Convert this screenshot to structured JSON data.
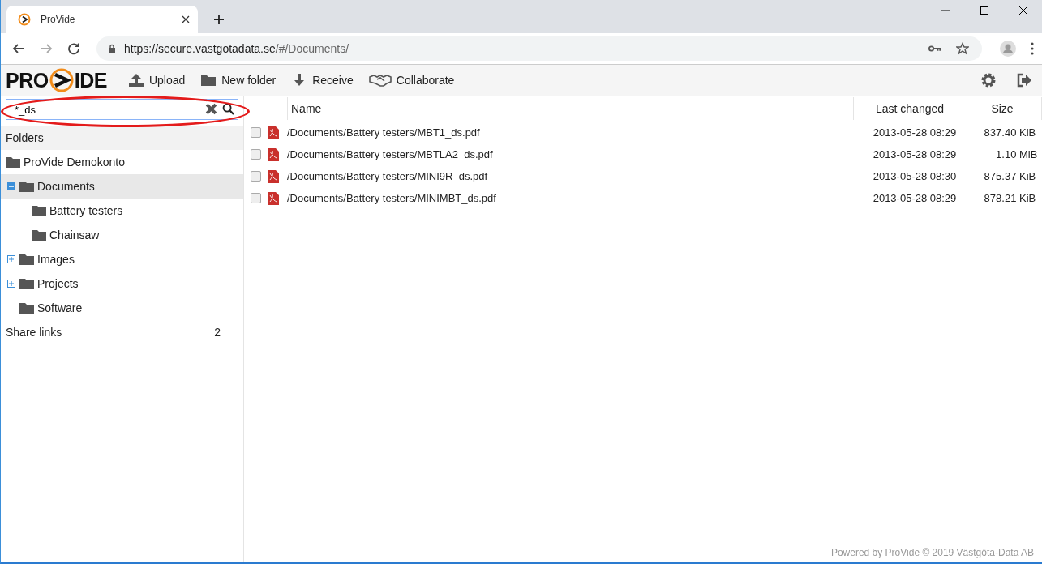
{
  "browser": {
    "tab_title": "ProVide",
    "url_host": "https://secure.vastgotadata.se",
    "url_path": "/#/Documents/"
  },
  "logo": {
    "left": "PRO",
    "right": "IDE"
  },
  "toolbar": [
    {
      "label": "Upload",
      "kind": "upload"
    },
    {
      "label": "New folder",
      "kind": "folder"
    },
    {
      "label": "Receive",
      "kind": "receive"
    },
    {
      "label": "Collaborate",
      "kind": "handshake"
    }
  ],
  "search": {
    "value": "*_ds",
    "highlighted": true
  },
  "sidebar": {
    "heading": "Folders",
    "tree": [
      {
        "label": "ProVide Demokonto",
        "selected": false,
        "children": [
          {
            "label": "Documents",
            "expanded": true,
            "selected": true,
            "children": [
              {
                "label": "Battery testers",
                "selected": false
              },
              {
                "label": "Chainsaw",
                "selected": false
              }
            ]
          },
          {
            "label": "Images",
            "expanded": false,
            "selected": false
          },
          {
            "label": "Projects",
            "expanded": false,
            "selected": false
          },
          {
            "label": "Software",
            "selected": false
          }
        ]
      }
    ],
    "share_links": {
      "label": "Share links",
      "count": "2"
    }
  },
  "table": {
    "columns": [
      "Name",
      "Last changed",
      "Size"
    ],
    "rows": [
      {
        "name": "/Documents/Battery testers/MBT1_ds.pdf",
        "changed": "2013-05-28 08:29",
        "size": "837.40",
        "unit": "KiB",
        "checked": false
      },
      {
        "name": "/Documents/Battery testers/MBTLA2_ds.pdf",
        "changed": "2013-05-28 08:29",
        "size": "1.10",
        "unit": "MiB",
        "checked": false
      },
      {
        "name": "/Documents/Battery testers/MINI9R_ds.pdf",
        "changed": "2013-05-28 08:30",
        "size": "875.37",
        "unit": "KiB",
        "checked": false
      },
      {
        "name": "/Documents/Battery testers/MINIMBT_ds.pdf",
        "changed": "2013-05-28 08:29",
        "size": "878.21",
        "unit": "KiB",
        "checked": false
      }
    ]
  },
  "footer": "Powered by ProVide © 2019 Västgöta-Data AB"
}
